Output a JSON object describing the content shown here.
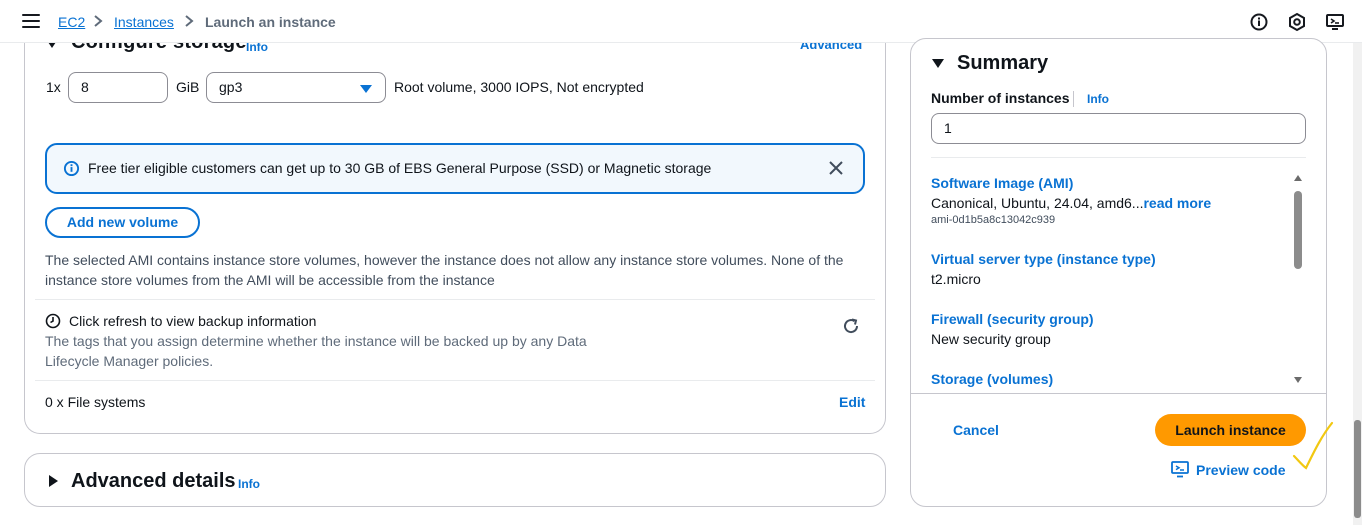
{
  "breadcrumb": {
    "items": [
      {
        "label": "EC2"
      },
      {
        "label": "Instances"
      },
      {
        "label": "Launch an instance"
      }
    ]
  },
  "top_icons": [
    "info-circle-icon",
    "settings-hex-icon",
    "feedback-monitor-icon"
  ],
  "storage": {
    "title": "Configure storage",
    "info": "Info",
    "advanced": "Advanced",
    "multiplier": "1x",
    "size_value": "8",
    "size_unit": "GiB",
    "volume_type": "gp3",
    "description": "Root volume,  3000 IOPS,  Not encrypted",
    "alert_text": "Free tier eligible customers can get up to 30 GB of EBS General Purpose (SSD) or Magnetic storage",
    "add_volume": "Add new volume",
    "ami_note": "The selected AMI contains instance store volumes, however the instance does not allow any instance store volumes. None of the instance store volumes from the AMI will be accessible from the instance",
    "backup_title": "Click refresh to view backup information",
    "backup_desc": "The tags that you assign determine whether the instance will be backed up by any Data Lifecycle Manager policies.",
    "file_systems": "0 x File systems",
    "edit": "Edit"
  },
  "advanced_details": {
    "title": "Advanced details",
    "info": "Info"
  },
  "summary": {
    "title": "Summary",
    "instances_label": "Number of instances",
    "info": "Info",
    "instances_value": "1",
    "ami_label": "Software Image (AMI)",
    "ami_value": "Canonical, Ubuntu, 24.04, amd6...",
    "read_more": "read more",
    "ami_id": "ami-0d1b5a8c13042c939",
    "type_label": "Virtual server type (instance type)",
    "type_value": "t2.micro",
    "firewall_label": "Firewall (security group)",
    "firewall_value": "New security group",
    "storage_label": "Storage (volumes)",
    "cancel": "Cancel",
    "launch": "Launch instance",
    "preview": "Preview code"
  },
  "colors": {
    "link": "#0972d3",
    "primary_button": "#ff9900",
    "annotation": "#f2c811"
  }
}
